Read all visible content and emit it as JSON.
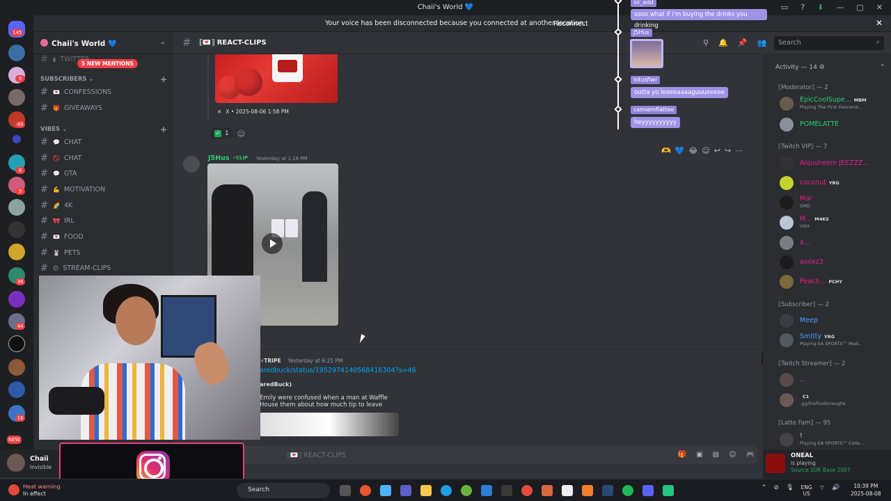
{
  "window": {
    "title": "Chaii's World",
    "heart": "💙"
  },
  "banner": {
    "message": "Your voice has been disconnected because you connected at another location.",
    "reconnect": "Reconnect"
  },
  "guilds": {
    "badges": [
      "145",
      "9",
      "49",
      "8",
      "5",
      "36",
      "44",
      "16",
      "NEW"
    ]
  },
  "server": {
    "name": "Chaii's World 💙"
  },
  "mentions": "5 NEW MENTIONS",
  "categories": {
    "subscribers": "SUBSCRIBERS",
    "vibes": "VIBES"
  },
  "channels": [
    {
      "label": "TWITTER",
      "emoji": "▮"
    },
    {
      "label": "CONFESSIONS",
      "emoji": "💌"
    },
    {
      "label": "GIVEAWAYS",
      "emoji": "🎁"
    },
    {
      "label": "CHAT",
      "emoji": "💬"
    },
    {
      "label": "CHAT",
      "emoji": "🚫"
    },
    {
      "label": "GTA",
      "emoji": "💬"
    },
    {
      "label": "MOTIVATION",
      "emoji": "💪"
    },
    {
      "label": "4K",
      "emoji": "🌈"
    },
    {
      "label": "IRL",
      "emoji": "🎀"
    },
    {
      "label": "FOOD",
      "emoji": "💌"
    },
    {
      "label": "PETS",
      "emoji": "🐰"
    },
    {
      "label": "STREAM-CLIPS",
      "emoji": "😊"
    }
  ],
  "user": {
    "name": "Chaii",
    "status": "Invisible"
  },
  "channel": {
    "name": "REACT-CLIPS",
    "prefix": "⟦💌⟧"
  },
  "search": {
    "placeholder": "Search"
  },
  "messages": {
    "embed_footer": "X • 2025-08-06 1:58 PM",
    "reaction_count": "1",
    "msg1": {
      "author": "J5Hus",
      "badge": "⚡CLIP",
      "time": "Yesterday at 1:16 PM"
    },
    "msg2": {
      "badge": "⚡TRIPE",
      "time": "Yesterday at 6:21 PM",
      "link": "aredbuck/status/1952974140568416304?s=46",
      "card_title": "aredBuck)",
      "card_text": "Emily were confused when a man at Waffle House them about how much tip to leave"
    }
  },
  "composer": {
    "placeholder": "⟦💌⟧ REACT-CLIPS"
  },
  "members": {
    "header": "Activity — 14",
    "groups": [
      {
        "role": "⟦Moderator⟧ — 2",
        "members": [
          {
            "name": "EpicCoolSupe...",
            "tag": "MBM",
            "sub": "Playing The First Descend...",
            "color": "#2ecc71"
          },
          {
            "name": "POMELATTE",
            "tag": "",
            "sub": "",
            "color": "#2ecc71"
          }
        ]
      },
      {
        "role": "⟦Twitch VIP⟧ — 7",
        "members": [
          {
            "name": "Alqusheem JEEZZZ...",
            "tag": "",
            "sub": "",
            "color": "#e91e8c"
          },
          {
            "name": "coconut",
            "tag": "YRG",
            "sub": "",
            "color": "#e91e8c"
          },
          {
            "name": "Mar",
            "tag": "",
            "sub": "SMD",
            "color": "#e91e8c"
          },
          {
            "name": "M...",
            "tag": "M4KS",
            "sub": "USH",
            "color": "#e91e8c"
          },
          {
            "name": "x...",
            "tag": "",
            "sub": "",
            "color": "#e91e8c"
          },
          {
            "name": "aooxz3",
            "tag": "",
            "sub": "",
            "color": "#e91e8c"
          },
          {
            "name": "Peach...",
            "tag": "PCHY",
            "sub": "",
            "color": "#e91e8c"
          }
        ]
      },
      {
        "role": "⟦Subscriber⟧ — 2",
        "members": [
          {
            "name": "Meep",
            "tag": "",
            "sub": "",
            "color": "#4e9cff"
          },
          {
            "name": "Smitty",
            "tag": "YRG",
            "sub": "Playing EA SPORTS™ Mad...",
            "color": "#4e9cff"
          }
        ]
      },
      {
        "role": "⟦Twitch Streamer⟧ — 2",
        "members": [
          {
            "name": "...",
            "tag": "",
            "sub": "",
            "color": "#9b59b6"
          },
          {
            "name": "",
            "tag": "C1",
            "sub": ".gg/thefiveboroughs",
            "color": "#9b59b6"
          }
        ]
      },
      {
        "role": "⟦Latte Fam⟧ — 95",
        "members": [
          {
            "name": "!",
            "tag": "",
            "sub": "Playing EA SPORTS™ Colle...",
            "color": "#dbdee1"
          }
        ]
      }
    ]
  },
  "overlay": {
    "items": [
      {
        "name": "sir_edd",
        "text": "sooo what if i'm buying the drinks you drinking"
      },
      {
        "name": "J5Hus",
        "text": ""
      },
      {
        "name": "lotusflwr",
        "text": "outta yo leeeeaaaaguuueeeee"
      },
      {
        "name": "camiemflattee",
        "text": "heyyyyyyyyyy"
      }
    ]
  },
  "game": {
    "name": "ONEAL",
    "status": "is playing",
    "game": "Source SDK Base 2007"
  },
  "taskbar": {
    "warning_title": "Heat warning",
    "warning_sub": "In effect",
    "search": "Search",
    "lang1": "ENG",
    "lang2": "US",
    "time": "10:39 PM",
    "date": "2025-08-08"
  }
}
